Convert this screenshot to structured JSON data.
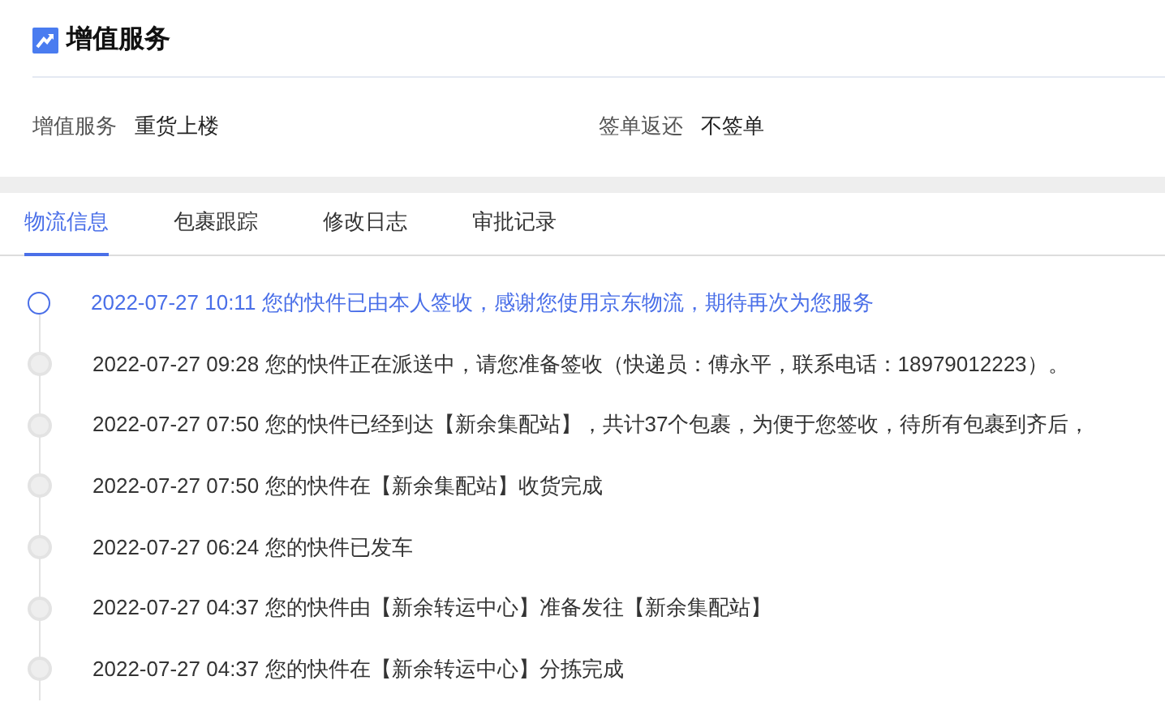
{
  "section": {
    "title": "增值服务"
  },
  "info": [
    {
      "label": "增值服务",
      "value": "重货上楼"
    },
    {
      "label": "签单返还",
      "value": "不签单"
    }
  ],
  "tabs": [
    {
      "label": "物流信息",
      "selected": true
    },
    {
      "label": "包裹跟踪",
      "selected": false
    },
    {
      "label": "修改日志",
      "selected": false
    },
    {
      "label": "审批记录",
      "selected": false
    }
  ],
  "timeline": [
    {
      "time": "2022-07-27 10:11",
      "text": "您的快件已由本人签收，感谢您使用京东物流，期待再次为您服务",
      "current": true
    },
    {
      "time": "2022-07-27 09:28",
      "text": "您的快件正在派送中，请您准备签收（快递员：傅永平，联系电话：18979012223）。",
      "current": false
    },
    {
      "time": "2022-07-27 07:50",
      "text": "您的快件已经到达【新余集配站】，共计37个包裹，为便于您签收，待所有包裹到齐后，",
      "current": false
    },
    {
      "time": "2022-07-27 07:50",
      "text": "您的快件在【新余集配站】收货完成",
      "current": false
    },
    {
      "time": "2022-07-27 06:24",
      "text": "您的快件已发车",
      "current": false
    },
    {
      "time": "2022-07-27 04:37",
      "text": "您的快件由【新余转运中心】准备发往【新余集配站】",
      "current": false
    },
    {
      "time": "2022-07-27 04:37",
      "text": "您的快件在【新余转运中心】分拣完成",
      "current": false
    }
  ]
}
